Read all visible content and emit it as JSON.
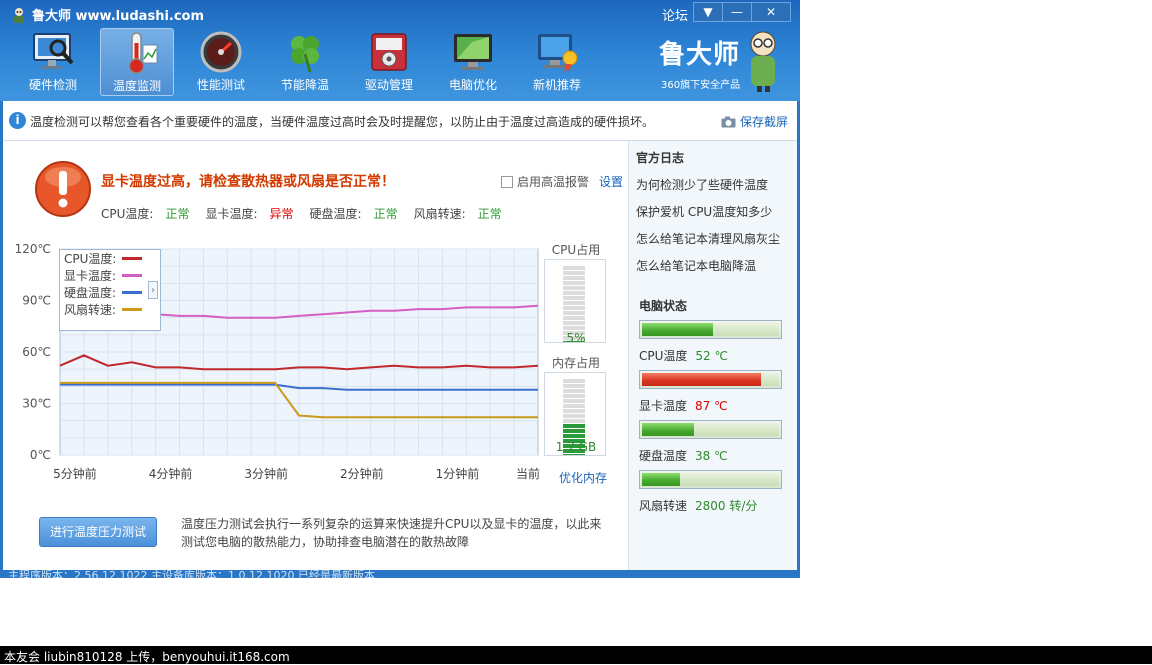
{
  "window": {
    "title": "鲁大师 www.ludashi.com",
    "forum_label": "论坛",
    "controls": [
      "▼",
      "—",
      "✕"
    ]
  },
  "nav": [
    {
      "label": "硬件检测",
      "icon": "hardware-check-icon",
      "active": false
    },
    {
      "label": "温度监测",
      "icon": "thermometer-icon",
      "active": true
    },
    {
      "label": "性能测试",
      "icon": "speedometer-icon",
      "active": false
    },
    {
      "label": "节能降温",
      "icon": "clover-icon",
      "active": false
    },
    {
      "label": "驱动管理",
      "icon": "driver-icon",
      "active": false
    },
    {
      "label": "电脑优化",
      "icon": "monitor-optimize-icon",
      "active": false
    },
    {
      "label": "新机推荐",
      "icon": "new-pc-icon",
      "active": false
    }
  ],
  "brand": {
    "name": "鲁大师",
    "sub": "360旗下安全产品"
  },
  "info_bar": {
    "text": "温度检测可以帮您查看各个重要硬件的温度，当硬件温度过高时会及时提醒您，以防止由于温度过高造成的硬件损坏。",
    "save_label": "保存截屏"
  },
  "alert": {
    "title": "显卡温度过高，请检查散热器或风扇是否正常！",
    "alarm_label": "启用高温报警",
    "settings_label": "设置"
  },
  "status_row": [
    {
      "label": "CPU温度:",
      "value": "正常",
      "ok": true
    },
    {
      "label": "显卡温度:",
      "value": "异常",
      "ok": false
    },
    {
      "label": "硬盘温度:",
      "value": "正常",
      "ok": true
    },
    {
      "label": "风扇转速:",
      "value": "正常",
      "ok": true
    }
  ],
  "legend": [
    {
      "label": "CPU温度:",
      "color": "#c0282d"
    },
    {
      "label": "显卡温度:",
      "color": "#d35fc2"
    },
    {
      "label": "硬盘温度:",
      "color": "#3a6fd0"
    },
    {
      "label": "风扇转速:",
      "color": "#c99a1c"
    }
  ],
  "chart_data": {
    "type": "line",
    "y_ticks": [
      "120℃",
      "90℃",
      "60℃",
      "30℃",
      "0℃"
    ],
    "x_ticks": [
      "5分钟前",
      "4分钟前",
      "3分钟前",
      "2分钟前",
      "1分钟前",
      "当前"
    ],
    "ylim": [
      0,
      120
    ],
    "grid": true,
    "x": [
      0,
      0.25,
      0.5,
      0.75,
      1,
      1.25,
      1.5,
      1.75,
      2,
      2.25,
      2.5,
      2.75,
      3,
      3.25,
      3.5,
      3.75,
      4,
      4.25,
      4.5,
      4.75,
      5
    ],
    "series": [
      {
        "name": "CPU温度",
        "color": "#c0282d",
        "values": [
          52,
          58,
          52,
          54,
          51,
          51,
          50,
          50,
          50,
          50,
          51,
          51,
          50,
          51,
          52,
          51,
          51,
          52,
          51,
          51,
          52
        ]
      },
      {
        "name": "显卡温度",
        "color": "#d35fc2",
        "values": [
          85,
          84,
          83,
          82,
          82,
          81,
          81,
          80,
          80,
          80,
          81,
          82,
          83,
          84,
          84,
          85,
          85,
          86,
          86,
          86,
          87
        ]
      },
      {
        "name": "硬盘温度",
        "color": "#3a6fd0",
        "values": [
          41,
          41,
          41,
          41,
          41,
          41,
          41,
          41,
          41,
          41,
          39,
          39,
          38,
          38,
          38,
          38,
          38,
          38,
          38,
          38,
          38
        ]
      },
      {
        "name": "风扇转速",
        "color": "#c99a1c",
        "values": [
          42,
          42,
          42,
          42,
          42,
          42,
          42,
          42,
          42,
          42,
          23,
          22,
          22,
          22,
          22,
          22,
          22,
          22,
          22,
          22,
          22
        ]
      }
    ]
  },
  "gauges": {
    "cpu": {
      "title": "CPU占用",
      "value": "5%",
      "fraction": 0.05
    },
    "mem": {
      "title": "内存占用",
      "value": "1.7 GB",
      "fraction": 0.45
    },
    "optimize_label": "优化内存"
  },
  "stress": {
    "button_label": "进行温度压力测试",
    "description": "温度压力测试会执行一系列复杂的运算来快速提升CPU以及显卡的温度，以此来测试您电脑的散热能力，协助排查电脑潜在的散热故障"
  },
  "side": {
    "log_title": "官方日志",
    "log_links": [
      "为何检测少了些硬件温度",
      "保护爱机 CPU温度知多少",
      "怎么给笔记本清理风扇灰尘",
      "怎么给笔记本电脑降温"
    ],
    "pc_title": "电脑状态",
    "pc_items": [
      {
        "label": "CPU温度",
        "value": "52 ℃",
        "fraction": 0.52,
        "color": "green"
      },
      {
        "label": "显卡温度",
        "value": "87 ℃",
        "fraction": 0.87,
        "color": "red"
      },
      {
        "label": "硬盘温度",
        "value": "38 ℃",
        "fraction": 0.38,
        "color": "green"
      },
      {
        "label": "风扇转速",
        "value": "2800 转/分",
        "fraction": 0.28,
        "color": "green"
      }
    ]
  },
  "status_bar": "主程序版本：2.56.12.1022  主设备库版本：1.0.12.1020  已经是最新版本",
  "watermark": "本友会 liubin810128 上传，benyouhui.it168.com"
}
